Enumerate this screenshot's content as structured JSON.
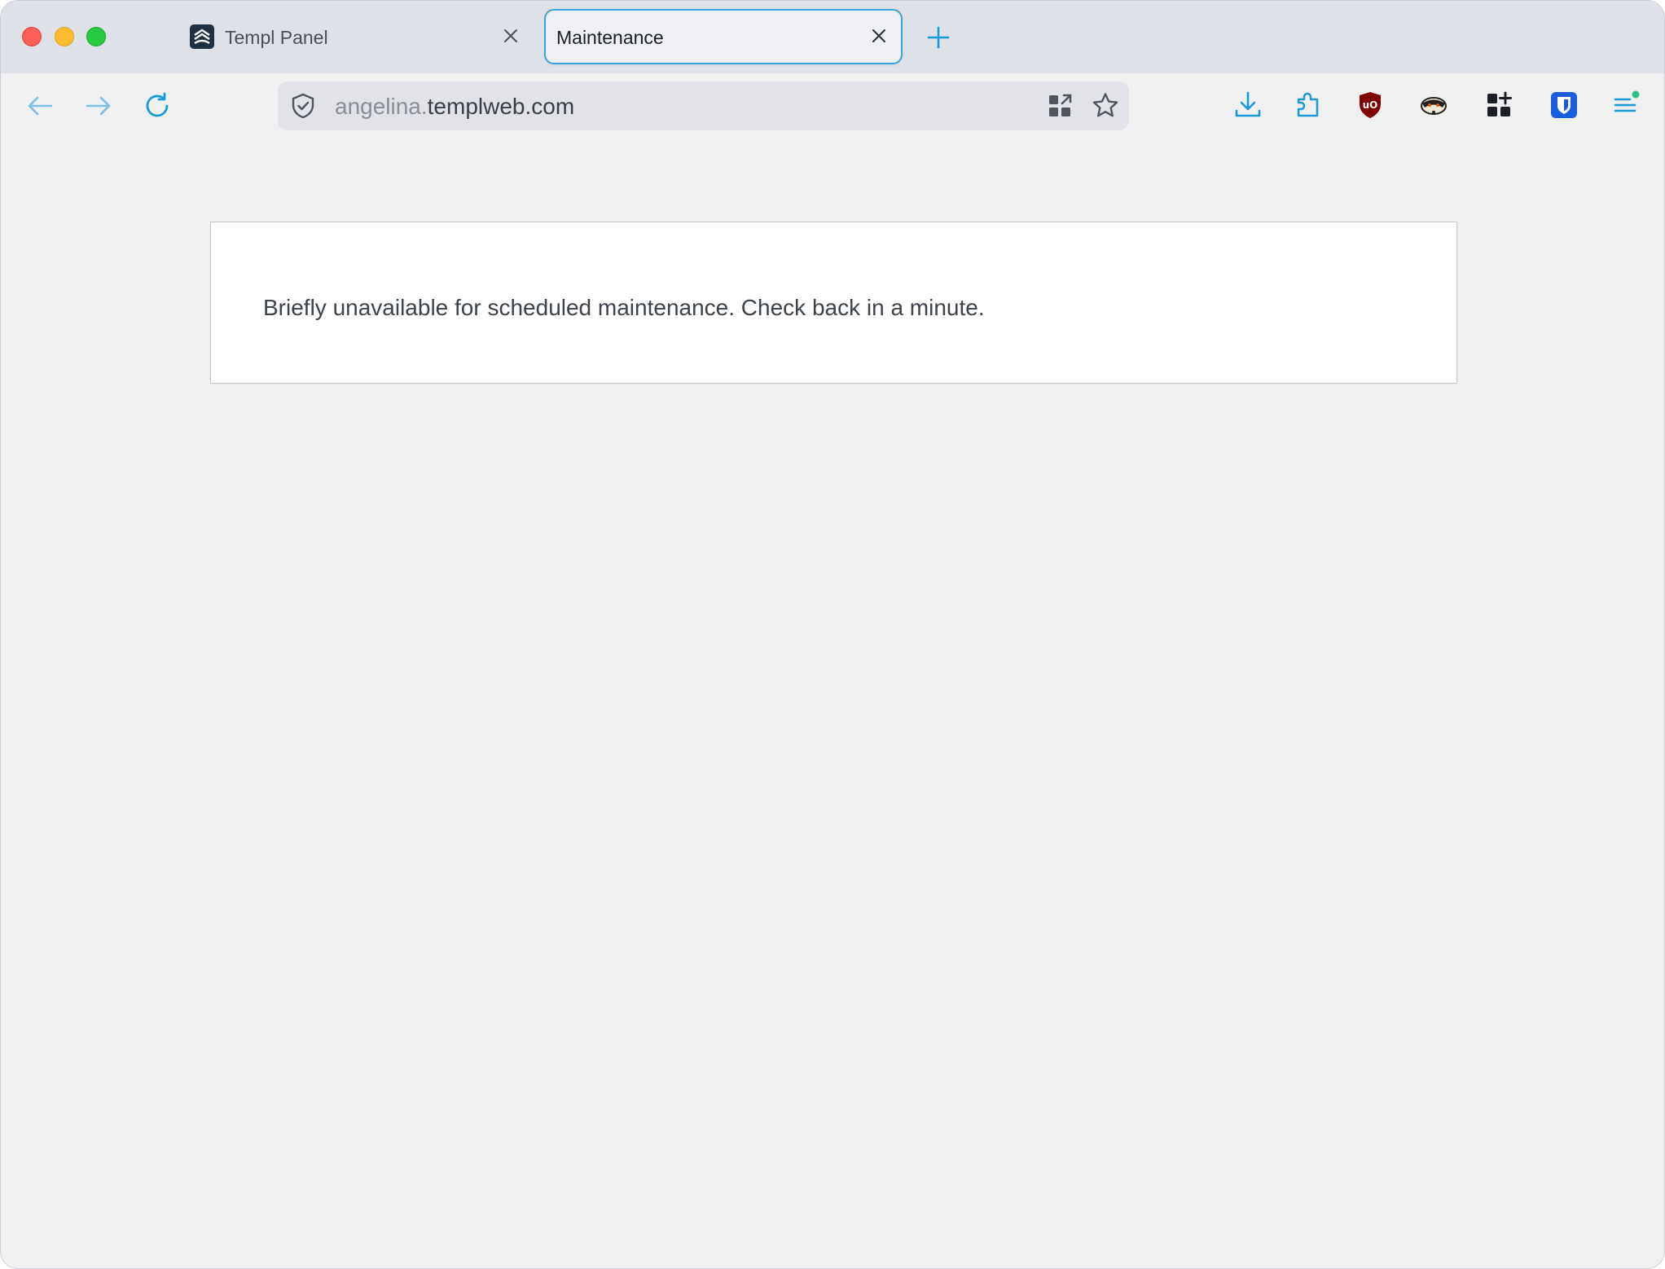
{
  "window": {
    "controls": [
      "close",
      "minimize",
      "zoom"
    ]
  },
  "tabs": [
    {
      "label": "Templ Panel",
      "icon": "templ-panel-favicon",
      "active": false
    },
    {
      "label": "Maintenance",
      "active": true
    }
  ],
  "toolbar": {
    "icons": [
      "back-icon",
      "forward-icon",
      "reload-icon",
      "download-icon",
      "extensions-icon",
      "ublock-icon",
      "privacy-badger-icon",
      "apps-icon",
      "bitwarden-icon",
      "menu-icon"
    ]
  },
  "urlbar": {
    "subdomain": "angelina.",
    "domain": "templweb.com"
  },
  "page": {
    "message": "Briefly unavailable for scheduled maintenance. Check back in a minute."
  },
  "colors": {
    "accent": "#39a3e3",
    "tabstrip": "#dfe1e8",
    "page_bg": "#f0f0f1",
    "ublock_red": "#800000",
    "bitwarden_blue": "#175ddc"
  }
}
